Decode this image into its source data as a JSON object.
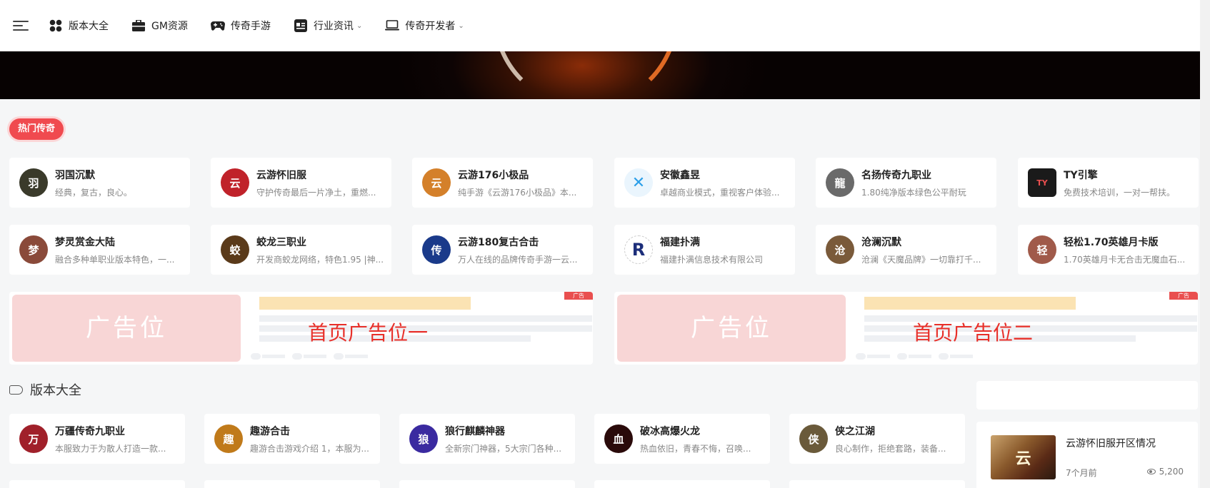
{
  "nav": {
    "items": [
      {
        "label": "版本大全",
        "icon": "grid-icon",
        "dropdown": false
      },
      {
        "label": "GM资源",
        "icon": "briefcase-icon",
        "dropdown": false
      },
      {
        "label": "传奇手游",
        "icon": "gamepad-icon",
        "dropdown": false
      },
      {
        "label": "行业资讯",
        "icon": "news-icon",
        "dropdown": true
      },
      {
        "label": "传奇开发者",
        "icon": "laptop-icon",
        "dropdown": true
      }
    ],
    "caret": "⌄"
  },
  "hot": {
    "tag": "热门传奇",
    "cards": [
      {
        "title": "羽国沉默",
        "desc": "经典，复古，良心。",
        "avatar_text": "羽",
        "color": "#3a3a2a"
      },
      {
        "title": "云游怀旧服",
        "desc": "守护传奇最后一片净土，重燃...",
        "avatar_text": "云",
        "color": "#c0222a"
      },
      {
        "title": "云游176小极品",
        "desc": "纯手游《云游176小极品》本...",
        "avatar_text": "云",
        "color": "#d4802a"
      },
      {
        "title": "安徽鑫昱",
        "desc": "卓越商业模式，重视客户体验...",
        "avatar_text": "✕",
        "color": "#2a9ee8"
      },
      {
        "title": "名扬传奇九职业",
        "desc": "1.80纯净版本绿色公平耐玩",
        "avatar_text": "龍",
        "color": "#6a6a6a"
      },
      {
        "title": "TY引擎",
        "desc": "免费技术培训，一对一帮扶。",
        "avatar_text": "TY",
        "color": "#1a1a1a"
      },
      {
        "title": "梦灵赏金大陆",
        "desc": "融合多种单职业版本特色，一...",
        "avatar_text": "梦",
        "color": "#8a4a3a"
      },
      {
        "title": "蛟龙三职业",
        "desc": "开发商蛟龙网络，特色1.95 |神...",
        "avatar_text": "蛟",
        "color": "#5a3a1a"
      },
      {
        "title": "云游180复古合击",
        "desc": "万人在线的品牌传奇手游一云...",
        "avatar_text": "传",
        "color": "#1a3a8a"
      },
      {
        "title": "福建扑满",
        "desc": "福建扑满信息技术有限公司",
        "avatar_text": "R",
        "color": "#1c2e7a"
      },
      {
        "title": "沧澜沉默",
        "desc": "沧澜《天魔品牌》一切靠打千...",
        "avatar_text": "沧",
        "color": "#7a5a3a"
      },
      {
        "title": "轻松1.70英雄月卡版",
        "desc": "1.70英雄月卡无合击无魔血石...",
        "avatar_text": "轻",
        "color": "#a05a4a"
      }
    ]
  },
  "ads": [
    {
      "placeholder": "广告位",
      "title": "首页广告位一",
      "badge": "广告"
    },
    {
      "placeholder": "广告位",
      "title": "首页广告位二",
      "badge": "广告"
    }
  ],
  "section": {
    "title": "版本大全"
  },
  "versions": [
    {
      "title": "万疆传奇九职业",
      "desc": "本服致力于为散人打造一款...",
      "avatar_text": "万",
      "color": "#a0202a"
    },
    {
      "title": "趣游合击",
      "desc": "趣游合击游戏介绍 1，本服为...",
      "avatar_text": "趣",
      "color": "#c07a1a"
    },
    {
      "title": "狼行麒麟神器",
      "desc": "全新宗门神器，5大宗门各种...",
      "avatar_text": "狼",
      "color": "#3a2aa0"
    },
    {
      "title": "破冰高爆火龙",
      "desc": "热血依旧，青春不悔，召唤...",
      "avatar_text": "血",
      "color": "#2a0a0a"
    },
    {
      "title": "侠之江湖",
      "desc": "良心制作，拒绝套路，装备...",
      "avatar_text": "侠",
      "color": "#6a5a3a"
    }
  ],
  "sidebar": {
    "post": {
      "title": "云游怀旧服开区情况",
      "time": "7个月前",
      "views": "5,200",
      "thumb_text": "云"
    }
  }
}
